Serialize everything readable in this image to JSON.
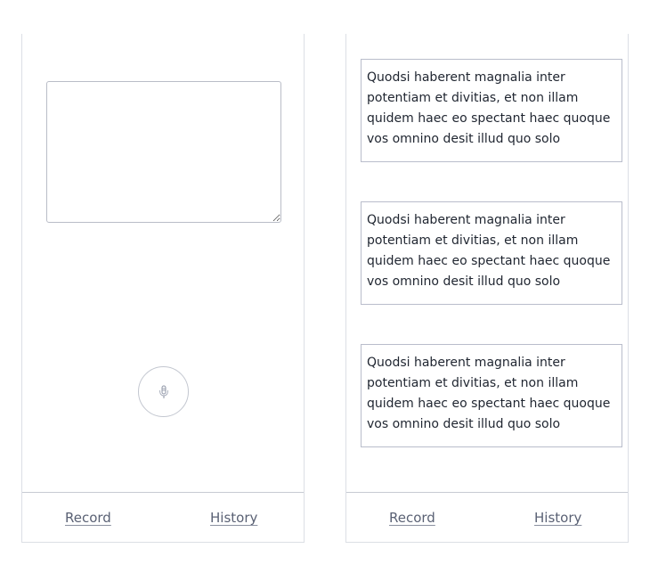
{
  "record_screen": {
    "transcript_input": {
      "value": "",
      "placeholder": ""
    },
    "mic_button": {
      "icon": "microphone-icon"
    },
    "tabs": [
      {
        "label": "Record"
      },
      {
        "label": "History"
      }
    ]
  },
  "history_screen": {
    "entries": [
      {
        "text": "Quodsi haberent magnalia inter potentiam et divitias, et non illam quidem haec eo spectant haec quoque vos omnino desit illud quo solo"
      },
      {
        "text": "Quodsi haberent magnalia inter potentiam et divitias, et non illam quidem haec eo spectant haec quoque vos omnino desit illud quo solo"
      },
      {
        "text": "Quodsi haberent magnalia inter potentiam et divitias, et non illam quidem haec eo spectant haec quoque vos omnino desit illud quo solo"
      }
    ],
    "tabs": [
      {
        "label": "Record"
      },
      {
        "label": "History"
      }
    ]
  },
  "colors": {
    "border": "#dcdfe5",
    "input_border": "#b9bdc7",
    "tab_text": "#5a6174",
    "body_text": "#1f2530"
  }
}
